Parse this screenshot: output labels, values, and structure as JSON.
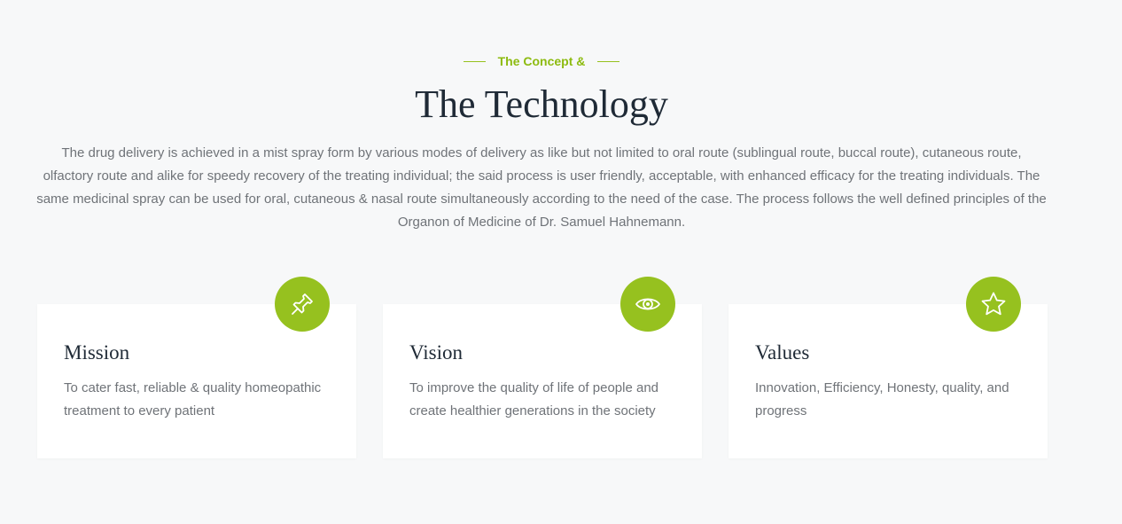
{
  "section": {
    "eyebrow": "The Concept &",
    "title": "The Technology",
    "description": "The drug delivery is achieved in a mist spray form by various modes of delivery as like but not limited to oral route (sublingual route, buccal route), cutaneous route, olfactory route and alike for speedy recovery of the treating individual; the said process is user friendly, acceptable, with enhanced efficacy for the treating individuals. The same medicinal spray can be used for oral, cutaneous & nasal route simultaneously according to the need of the case. The process follows the well defined principles of the Organon of Medicine of Dr. Samuel Hahnemann."
  },
  "cards": [
    {
      "icon": "pin-icon",
      "title": "Mission",
      "text": "To cater fast, reliable & quality homeopathic treatment to every patient"
    },
    {
      "icon": "eye-icon",
      "title": "Vision",
      "text": "To improve the quality of life of people and create healthier generations in the society"
    },
    {
      "icon": "star-icon",
      "title": "Values",
      "text": "Innovation, Efficiency, Honesty, quality, and progress"
    }
  ],
  "colors": {
    "accent": "#96c11f",
    "heading": "#1f2a36",
    "body_text": "#6f7378",
    "background": "#f7f8f9",
    "card": "#ffffff"
  }
}
